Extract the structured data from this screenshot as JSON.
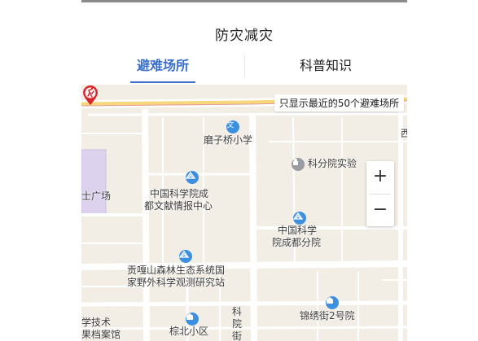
{
  "header": {
    "title": "防灾减灾"
  },
  "tabs": [
    {
      "label": "避难场所",
      "active": true
    },
    {
      "label": "科普知识",
      "active": false
    }
  ],
  "map": {
    "notice": "只显示最近的50个避难场所",
    "labels": {
      "school": "磨子桥小学",
      "institute_lab": "科分院实验",
      "guangchang": "士广场",
      "library_line1": "中国科学院成",
      "library_line2": "都文献情报中心",
      "branch_line1": "中国科学",
      "branch_line2": "院成都分院",
      "forest_line1": "贡嘎山森林生态系统国",
      "forest_line2": "家野外科学观测研究站",
      "archive_line1": "学技术",
      "archive_line2": "果档案馆",
      "zongbei": "棕北小区",
      "jinxiu": "锦绣街2号院",
      "kexue_jie_1": "科",
      "kexue_jie_2": "院",
      "kexue_jie_3": "街",
      "xi": "西"
    },
    "zoom_in": "+",
    "zoom_out": "−"
  },
  "colors": {
    "accent": "#3b6fc9",
    "poi_blue": "#3d8fe0",
    "poi_gray": "#9a9ca3",
    "pin_red": "#d9262c",
    "map_bg": "#f2eee6"
  },
  "icons": {
    "school": "school-icon",
    "shelter": "shelter-icon",
    "building": "building-icon",
    "pin": "shelter-marker-icon"
  }
}
